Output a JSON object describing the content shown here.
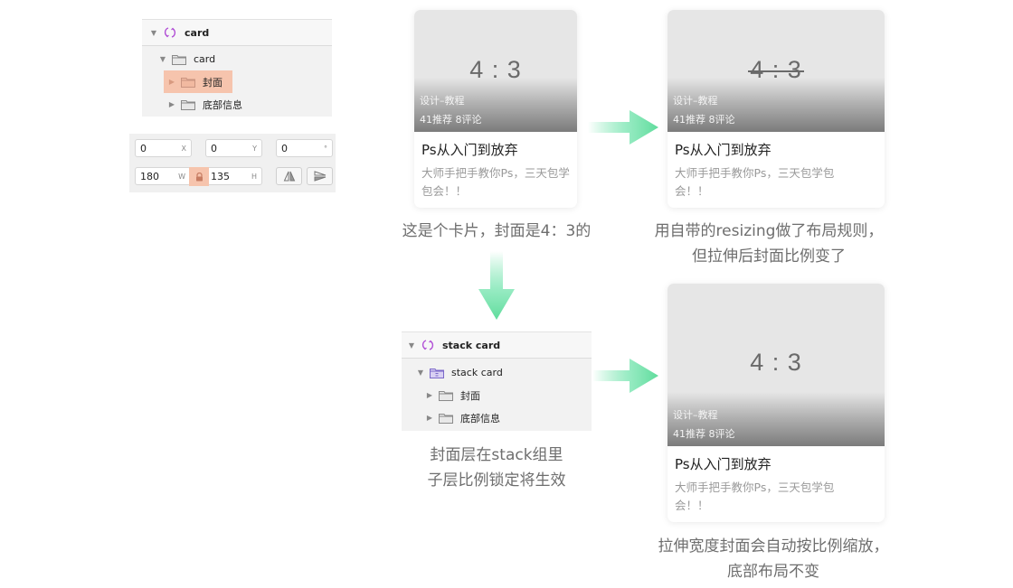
{
  "layers_top": {
    "symbol_name": "card",
    "group_name": "card",
    "children": [
      {
        "label": "封面",
        "selected": true
      },
      {
        "label": "底部信息",
        "selected": false
      }
    ]
  },
  "inspector": {
    "x": {
      "value": "0",
      "suffix": "X"
    },
    "y": {
      "value": "0",
      "suffix": "Y"
    },
    "rotation": {
      "value": "0",
      "suffix": "°"
    },
    "width": {
      "value": "180",
      "suffix": "W"
    },
    "height": {
      "value": "135",
      "suffix": "H"
    },
    "lock_ratio": true
  },
  "layers_stack": {
    "symbol_name": "stack card",
    "group_name": "stack card",
    "children": [
      {
        "label": "封面"
      },
      {
        "label": "底部信息"
      }
    ]
  },
  "cards": [
    {
      "ratio": "4 : 3",
      "category": "设计–教程",
      "stats": "41推荐  8评论",
      "title": "Ps从入门到放弃",
      "description": "大师手把手教你Ps，三天包学包会！！",
      "ratio_struck": false
    },
    {
      "ratio": "4 : 3",
      "category": "设计–教程",
      "stats": "41推荐  8评论",
      "title": "Ps从入门到放弃",
      "description": "大师手把手教你Ps，三天包学包会！！",
      "ratio_struck": true
    },
    {
      "ratio": "4 : 3",
      "category": "设计–教程",
      "stats": "41推荐  8评论",
      "title": "Ps从入门到放弃",
      "description": "大师手把手教你Ps，三天包学包会！！",
      "ratio_struck": false
    }
  ],
  "captions": {
    "card_intro": "这是个卡片，封面是4：3的",
    "resizing_line1": "用自带的resizing做了布局规则，",
    "resizing_line2": "但拉伸后封面比例变了",
    "stack_line1": "封面层在stack组里",
    "stack_line2": "子层比例锁定将生效",
    "result_line1": "拉伸宽度封面会自动按比例缩放，",
    "result_line2": "底部布局不变"
  },
  "colors": {
    "arrow": "#5fe0a0",
    "selection": "#f6c4ad",
    "symbol_icon": "#b14fd6"
  }
}
